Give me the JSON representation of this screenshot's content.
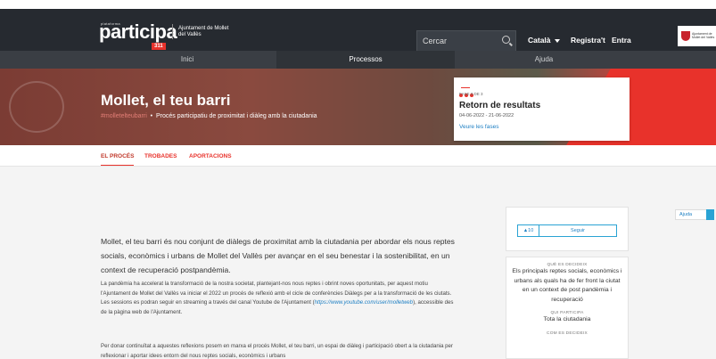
{
  "header": {
    "logo_small": "plataforma",
    "logo_text": "participa",
    "logo_badge": "311",
    "logo_sub": "Ajuntament de Mollet del Vallès",
    "search_placeholder": "Cercar",
    "language": "Català",
    "register": "Registra't",
    "login": "Entra",
    "ajuntament_logo": "Ajuntament de Mollet del Vallès"
  },
  "nav": {
    "items": [
      {
        "label": "Inici"
      },
      {
        "label": "Processos"
      },
      {
        "label": "Ajuda"
      }
    ]
  },
  "hero": {
    "title": "Mollet, el teu barri",
    "hashtag": "#molletelteubarri",
    "subtitle": "Procés participatiu de proximitat i diàleg amb la ciutadania"
  },
  "phase": {
    "step": "FASE 3 DE 3",
    "title": "Retorn de resultats",
    "dates": "04-06-2022 - 21-06-2022",
    "link": "Veure les fases"
  },
  "subnav": {
    "tabs": [
      "EL PROCÉS",
      "TROBADES",
      "APORTACIONS"
    ]
  },
  "help": "Ajuda",
  "content": {
    "intro": "Mollet, el teu barri és nou conjunt de diàlegs de proximitat amb la ciutadania per abordar els nous reptes socials, econòmics i urbans de Mollet del Vallès per avançar en el seu benestar i la sostenibilitat, en un context de recuperació postpandèmia.",
    "p1_a": "La pandèmia ha accelerat la transformació de la nostra societat, plantejant-nos nous reptes i obrint noves oportunitats, per aquest motiu l'Ajuntament de Mollet del Vallès va iniciar el 2022 un procés de reflexió amb el cicle de conferències Diàlegs per a la transformació de les ciutats. Les sessions es podran seguir en streaming a través del canal Youtube de l'Ajuntament (",
    "p1_link": "https://www.youtube.com/user/molletweb",
    "p1_b": "), accessible des de la pàgina web de l'Ajuntament.",
    "p2": "Per donar continuïtat a aquestes reflexions posem en marxa el procés Mollet, el teu barri, un espai de diàleg i participació obert a la ciutadania per reflexionar i aportar idees entorn del nous reptes socials, econòmics i urbans"
  },
  "sidebar": {
    "follow_count": "10",
    "follow_label": "Seguir",
    "decides_h": "QUÈ ES DECIDEIX",
    "decides_v": "Els principals reptes socials, econòmics i urbans als quals ha de fer front la ciutat en un context de post pandèmia i recuperació",
    "who_h": "QUI PARTICIPA",
    "who_v": "Tota la ciutadania",
    "how_h": "COM ES DECIDEIX"
  }
}
